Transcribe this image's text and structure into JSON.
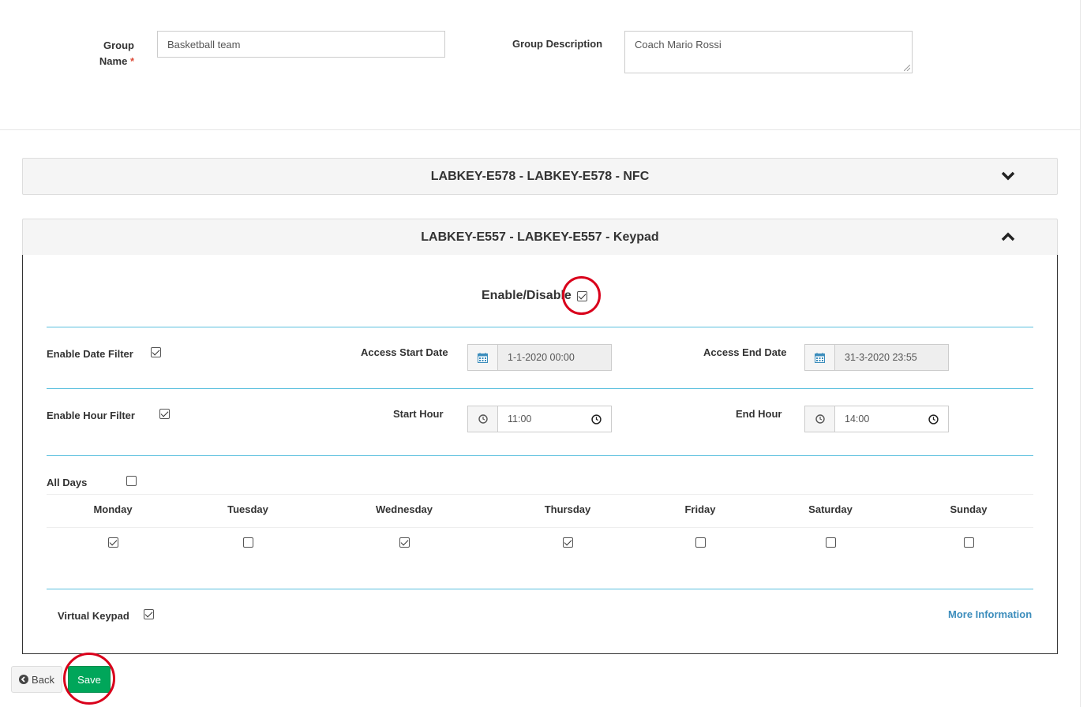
{
  "group_form": {
    "name_label_line1": "Group",
    "name_label_line2": "Name",
    "required_mark": "*",
    "name_value": "Basketball team",
    "description_label": "Group Description",
    "description_value": "Coach Mario Rossi"
  },
  "panels": [
    {
      "title": "LABKEY-E578 - LABKEY-E578 - NFC",
      "state": "collapsed",
      "chevron": "chevron-down-icon"
    },
    {
      "title": "LABKEY-E557 - LABKEY-E557 - Keypad",
      "state": "expanded",
      "chevron": "chevron-up-icon"
    }
  ],
  "keypad_panel": {
    "enable_disable_label": "Enable/Disable",
    "enable_disable_checked": true,
    "date_filter": {
      "label": "Enable Date Filter",
      "checked": true,
      "start_label": "Access Start Date",
      "start_value": "1-1-2020 00:00",
      "end_label": "Access End Date",
      "end_value": "31-3-2020 23:55"
    },
    "hour_filter": {
      "label": "Enable Hour Filter",
      "checked": true,
      "start_label": "Start Hour",
      "start_value": "11:00",
      "end_label": "End Hour",
      "end_value": "14:00"
    },
    "all_days_label": "All Days",
    "all_days_checked": false,
    "days": [
      {
        "label": "Monday",
        "checked": true
      },
      {
        "label": "Tuesday",
        "checked": false
      },
      {
        "label": "Wednesday",
        "checked": true
      },
      {
        "label": "Thursday",
        "checked": true
      },
      {
        "label": "Friday",
        "checked": false
      },
      {
        "label": "Saturday",
        "checked": false
      },
      {
        "label": "Sunday",
        "checked": false
      }
    ],
    "virtual_keypad_label": "Virtual Keypad",
    "virtual_keypad_checked": true,
    "more_info_label": "More Information"
  },
  "actions": {
    "back_label": "Back",
    "save_label": "Save"
  },
  "colors": {
    "accent_green": "#00a65a",
    "link_blue": "#3c8dbc",
    "divider_cyan": "#5bc0de",
    "highlight_red": "#d9001b"
  }
}
